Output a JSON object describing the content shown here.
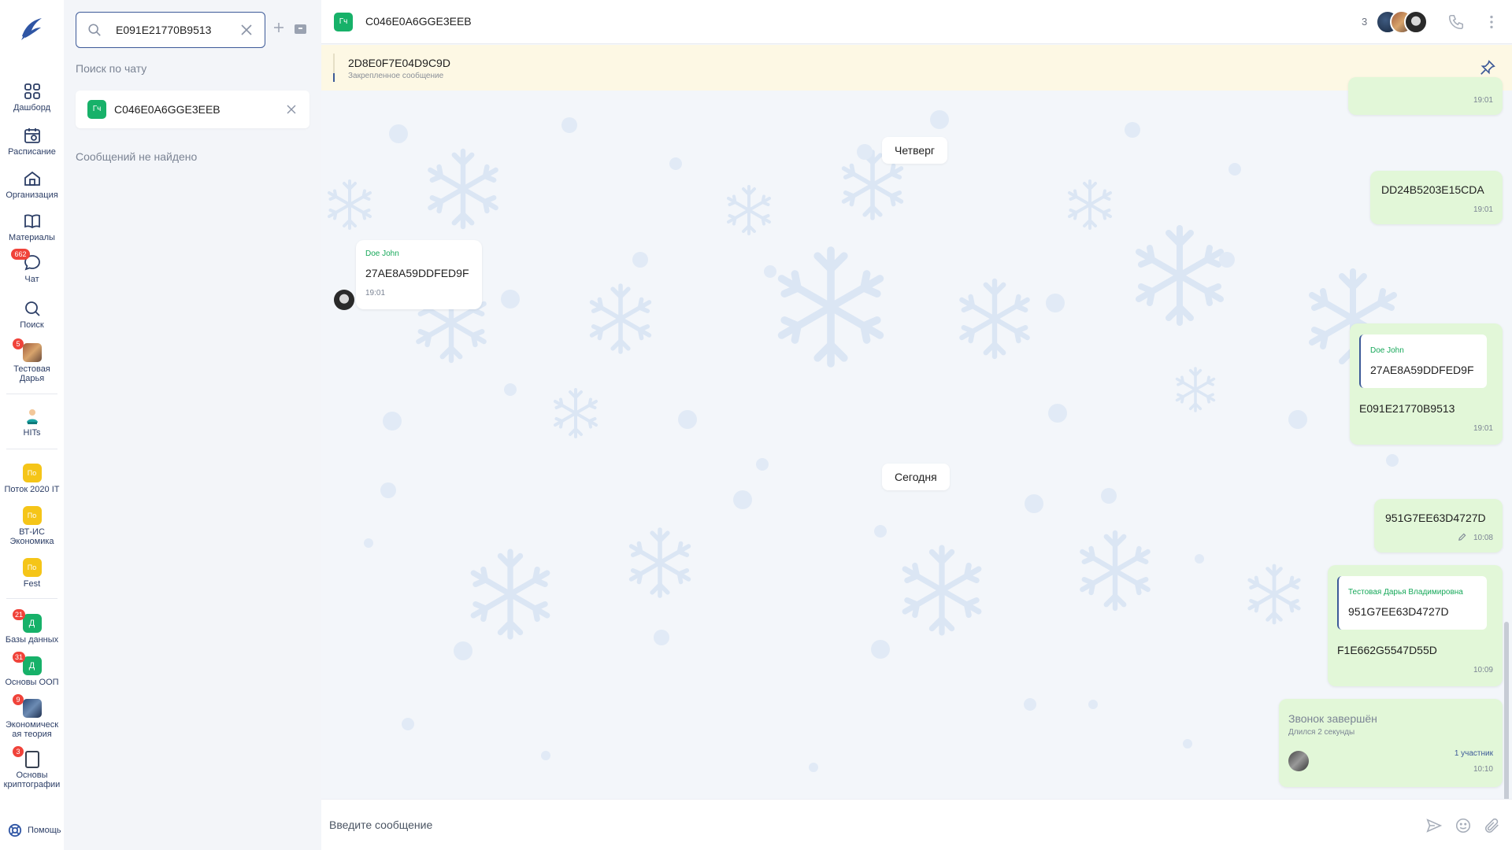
{
  "sidebar": {
    "items": [
      {
        "label": "Дашборд",
        "icon": "dashboard-icon"
      },
      {
        "label": "Расписание",
        "icon": "schedule-icon"
      },
      {
        "label": "Организация",
        "icon": "organization-icon"
      },
      {
        "label": "Материалы",
        "icon": "book-icon"
      },
      {
        "label": "Чат",
        "icon": "chat-icon",
        "badge": "662"
      },
      {
        "label": "Поиск",
        "icon": "search-icon"
      },
      {
        "label": "Тестовая Дарья",
        "icon": "user-avatar",
        "badge": "5"
      },
      {
        "label": "HITs",
        "icon": "hits-logo"
      },
      {
        "label": "Поток 2020 IT",
        "avatar_text": "По"
      },
      {
        "label": "ВТ-ИС Экономика",
        "avatar_text": "По"
      },
      {
        "label": "Fest",
        "avatar_text": "По"
      },
      {
        "label": "Базы данных",
        "avatar_text": "Д",
        "badge": "21"
      },
      {
        "label": "Основы ООП",
        "avatar_text": "Д",
        "badge": "31"
      },
      {
        "label": "Экономическая теория",
        "badge": "9"
      },
      {
        "label": "Основы криптографии",
        "badge": "3"
      }
    ],
    "help_label": "Помощь"
  },
  "search_panel": {
    "query": "E091E21770B9513",
    "hint": "Поиск по чату",
    "chip": {
      "avatar_text": "Гч",
      "title": "C046E0A6GGE3EEB"
    },
    "empty_text": "Сообщений не найдено"
  },
  "chat": {
    "header": {
      "avatar_text": "Гч",
      "title": "C046E0A6GGE3EEB",
      "members_count": "3"
    },
    "pinned": {
      "text": "2D8E0F7E04D9C9D",
      "label": "Закрепленное сообщение"
    },
    "partial_time": "19:01",
    "dates": {
      "thursday": "Четверг",
      "today": "Сегодня"
    },
    "messages": {
      "m1": {
        "text": "DD24B5203E15CDA",
        "time": "19:01"
      },
      "m2": {
        "sender": "Doe John",
        "text": "27AE8A59DDFED9F",
        "time": "19:01"
      },
      "m3": {
        "reply_name": "Doe John",
        "reply_text": "27AE8A59DDFED9F",
        "text": "E091E21770B9513",
        "time": "19:01"
      },
      "m4": {
        "text": "951G7EE63D4727D",
        "time": "10:08"
      },
      "m5": {
        "reply_name": "Тестовая Дарья Владимировна",
        "reply_text": "951G7EE63D4727D",
        "text": "F1E662G5547D55D",
        "time": "10:09"
      },
      "call": {
        "title": "Звонок завершён",
        "duration": "Длился 2 секунды",
        "participants": "1 участник",
        "time": "10:10"
      }
    },
    "composer_placeholder": "Введите сообщение"
  },
  "colors": {
    "accent": "#3d5a98",
    "green": "#17b169",
    "out_bubble": "#e2f7d8",
    "pinned_bg": "#fdf8e4",
    "badge": "#f0433a"
  }
}
